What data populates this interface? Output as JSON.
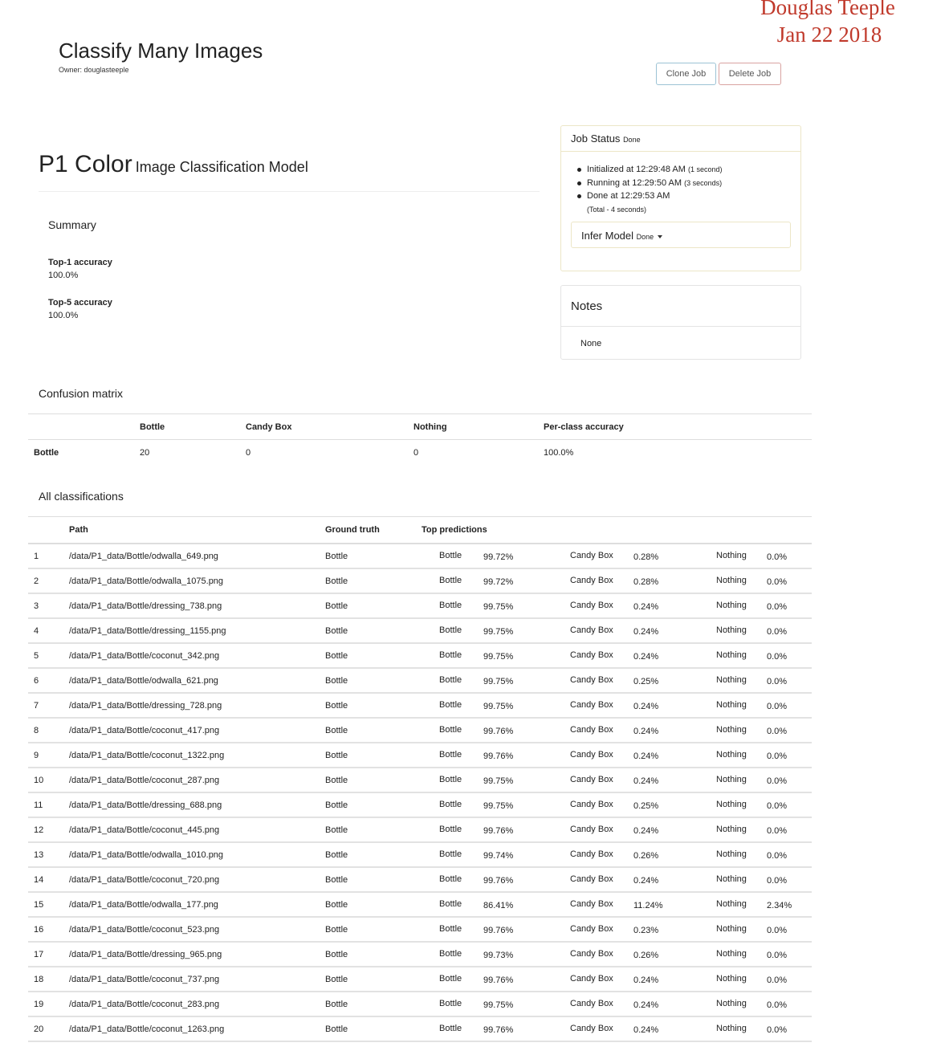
{
  "signature": {
    "name": "Douglas Teeple",
    "date": "Jan 22 2018"
  },
  "job": {
    "title": "Classify Many Images",
    "owner": "Owner: douglasteeple"
  },
  "buttons": {
    "clone": "Clone Job",
    "delete": "Delete Job"
  },
  "model": {
    "name": "P1 Color",
    "type": "Image Classification Model"
  },
  "summary": {
    "title": "Summary",
    "top1_label": "Top-1 accuracy",
    "top1_value": "100.0%",
    "top5_label": "Top-5 accuracy",
    "top5_value": "100.0%"
  },
  "job_status": {
    "title": "Job Status",
    "state": "Done",
    "events": [
      {
        "text": "Initialized at 12:29:48 AM",
        "detail": "(1 second)"
      },
      {
        "text": "Running at 12:29:50 AM",
        "detail": "(3 seconds)"
      },
      {
        "text": "Done at 12:29:53 AM",
        "detail": ""
      }
    ],
    "total": "(Total - 4 seconds)",
    "infer_label": "Infer Model",
    "infer_state": "Done"
  },
  "notes": {
    "title": "Notes",
    "body": "None"
  },
  "confusion": {
    "title": "Confusion matrix",
    "headers": [
      "",
      "Bottle",
      "Candy Box",
      "Nothing",
      "Per-class accuracy"
    ],
    "rows": [
      [
        "Bottle",
        "20",
        "0",
        "0",
        "100.0%"
      ]
    ]
  },
  "classifications": {
    "title": "All classifications",
    "headers": {
      "num": "",
      "path": "Path",
      "gt": "Ground truth",
      "preds": "Top predictions"
    },
    "pred_labels": [
      "Bottle",
      "Candy Box",
      "Nothing"
    ],
    "rows": [
      {
        "n": "1",
        "path": "/data/P1_data/Bottle/odwalla_649.png",
        "gt": "Bottle",
        "p": [
          "99.72%",
          "0.28%",
          "0.0%"
        ]
      },
      {
        "n": "2",
        "path": "/data/P1_data/Bottle/odwalla_1075.png",
        "gt": "Bottle",
        "p": [
          "99.72%",
          "0.28%",
          "0.0%"
        ]
      },
      {
        "n": "3",
        "path": "/data/P1_data/Bottle/dressing_738.png",
        "gt": "Bottle",
        "p": [
          "99.75%",
          "0.24%",
          "0.0%"
        ]
      },
      {
        "n": "4",
        "path": "/data/P1_data/Bottle/dressing_1155.png",
        "gt": "Bottle",
        "p": [
          "99.75%",
          "0.24%",
          "0.0%"
        ]
      },
      {
        "n": "5",
        "path": "/data/P1_data/Bottle/coconut_342.png",
        "gt": "Bottle",
        "p": [
          "99.75%",
          "0.24%",
          "0.0%"
        ]
      },
      {
        "n": "6",
        "path": "/data/P1_data/Bottle/odwalla_621.png",
        "gt": "Bottle",
        "p": [
          "99.75%",
          "0.25%",
          "0.0%"
        ]
      },
      {
        "n": "7",
        "path": "/data/P1_data/Bottle/dressing_728.png",
        "gt": "Bottle",
        "p": [
          "99.75%",
          "0.24%",
          "0.0%"
        ]
      },
      {
        "n": "8",
        "path": "/data/P1_data/Bottle/coconut_417.png",
        "gt": "Bottle",
        "p": [
          "99.76%",
          "0.24%",
          "0.0%"
        ]
      },
      {
        "n": "9",
        "path": "/data/P1_data/Bottle/coconut_1322.png",
        "gt": "Bottle",
        "p": [
          "99.76%",
          "0.24%",
          "0.0%"
        ]
      },
      {
        "n": "10",
        "path": "/data/P1_data/Bottle/coconut_287.png",
        "gt": "Bottle",
        "p": [
          "99.75%",
          "0.24%",
          "0.0%"
        ]
      },
      {
        "n": "11",
        "path": "/data/P1_data/Bottle/dressing_688.png",
        "gt": "Bottle",
        "p": [
          "99.75%",
          "0.25%",
          "0.0%"
        ]
      },
      {
        "n": "12",
        "path": "/data/P1_data/Bottle/coconut_445.png",
        "gt": "Bottle",
        "p": [
          "99.76%",
          "0.24%",
          "0.0%"
        ]
      },
      {
        "n": "13",
        "path": "/data/P1_data/Bottle/odwalla_1010.png",
        "gt": "Bottle",
        "p": [
          "99.74%",
          "0.26%",
          "0.0%"
        ]
      },
      {
        "n": "14",
        "path": "/data/P1_data/Bottle/coconut_720.png",
        "gt": "Bottle",
        "p": [
          "99.76%",
          "0.24%",
          "0.0%"
        ]
      },
      {
        "n": "15",
        "path": "/data/P1_data/Bottle/odwalla_177.png",
        "gt": "Bottle",
        "p": [
          "86.41%",
          "11.24%",
          "2.34%"
        ]
      },
      {
        "n": "16",
        "path": "/data/P1_data/Bottle/coconut_523.png",
        "gt": "Bottle",
        "p": [
          "99.76%",
          "0.23%",
          "0.0%"
        ]
      },
      {
        "n": "17",
        "path": "/data/P1_data/Bottle/dressing_965.png",
        "gt": "Bottle",
        "p": [
          "99.73%",
          "0.26%",
          "0.0%"
        ]
      },
      {
        "n": "18",
        "path": "/data/P1_data/Bottle/coconut_737.png",
        "gt": "Bottle",
        "p": [
          "99.76%",
          "0.24%",
          "0.0%"
        ]
      },
      {
        "n": "19",
        "path": "/data/P1_data/Bottle/coconut_283.png",
        "gt": "Bottle",
        "p": [
          "99.75%",
          "0.24%",
          "0.0%"
        ]
      },
      {
        "n": "20",
        "path": "/data/P1_data/Bottle/coconut_1263.png",
        "gt": "Bottle",
        "p": [
          "99.76%",
          "0.24%",
          "0.0%"
        ]
      }
    ]
  }
}
